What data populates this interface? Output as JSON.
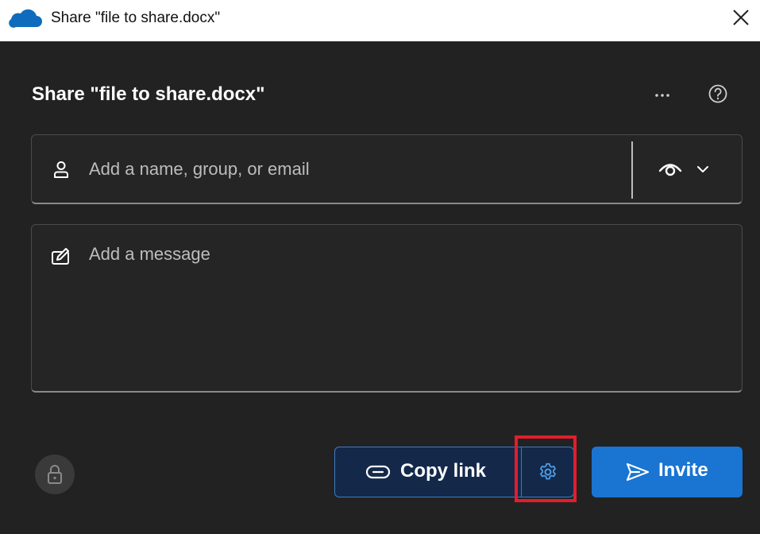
{
  "window": {
    "title": "Share \"file to share.docx\"",
    "app_icon": "onedrive-cloud-icon",
    "close_icon": "close-icon"
  },
  "dialog": {
    "heading": "Share \"file to share.docx\"",
    "more_options_icon": "more-options-icon",
    "help_icon": "help-icon",
    "people_field": {
      "placeholder": "Add a name, group, or email",
      "value": "",
      "icon": "person-icon",
      "permission_icon": "eye-icon",
      "permission_dropdown_icon": "chevron-down-icon"
    },
    "message_field": {
      "placeholder": "Add a message",
      "value": "",
      "icon": "compose-icon"
    },
    "lock_icon": "lock-icon",
    "copy_link_label": "Copy link",
    "copy_link_icon": "link-icon",
    "link_settings_icon": "gear-icon",
    "invite_label": "Invite",
    "invite_icon": "send-icon"
  },
  "colors": {
    "panel_background": "#222222",
    "accent": "#1a74d1",
    "copy_link_background": "#14294a",
    "highlight": "#e01e2d"
  }
}
